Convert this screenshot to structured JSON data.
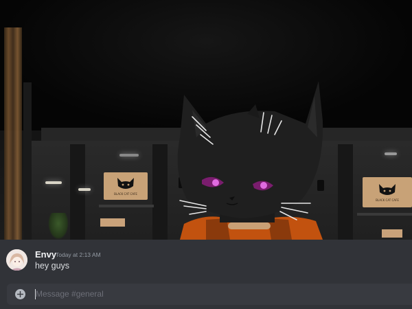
{
  "scene": {
    "description_icon": "vr-cat-avatar",
    "posters": [
      {
        "icon": "cat-logo-icon",
        "caption": "BLACK CAT CAFE"
      },
      {
        "icon": "cat-logo-icon",
        "caption": "BLACK CAT CAFE"
      }
    ]
  },
  "chat": {
    "message": {
      "username": "Envy",
      "timestamp": "Today at 2:13 AM",
      "text": "hey guys",
      "avatar_icon": "user-avatar"
    },
    "composer": {
      "placeholder": "Message #general",
      "add_icon": "plus-circle-icon"
    }
  },
  "colors": {
    "chat_bg": "#313338",
    "composer_bg": "#383a40",
    "username": "#f2f3f5",
    "timestamp": "#949ba4",
    "text": "#dbdee1"
  }
}
